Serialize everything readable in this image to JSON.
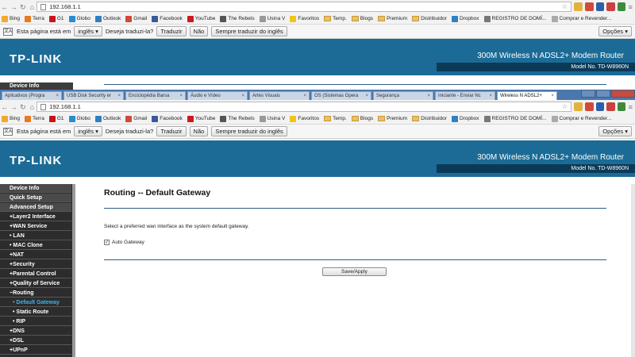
{
  "browser": {
    "url": "192.168.1.1",
    "bookmarks": [
      {
        "label": "Bing",
        "color": "#f3a92b",
        "kind": "icon"
      },
      {
        "label": "Terra",
        "color": "#e8791c",
        "kind": "icon"
      },
      {
        "label": "G1",
        "color": "#c4161c",
        "kind": "icon"
      },
      {
        "label": "Globo",
        "color": "#2a8bd1",
        "kind": "icon"
      },
      {
        "label": "Outlook",
        "color": "#2f7ec2",
        "kind": "icon"
      },
      {
        "label": "Gmail",
        "color": "#d44638",
        "kind": "icon"
      },
      {
        "label": "Facebook",
        "color": "#3b5998",
        "kind": "icon"
      },
      {
        "label": "YouTube",
        "color": "#cc181e",
        "kind": "icon"
      },
      {
        "label": "The Rebels",
        "color": "#555555",
        "kind": "icon"
      },
      {
        "label": "Usina V",
        "color": "#999999",
        "kind": "icon"
      },
      {
        "label": "Favoritos",
        "color": "#f0c419",
        "kind": "icon"
      },
      {
        "label": "Temp.",
        "kind": "folder"
      },
      {
        "label": "Blogs",
        "kind": "folder"
      },
      {
        "label": "Premium",
        "kind": "folder"
      },
      {
        "label": "Distribuidor",
        "kind": "folder"
      },
      {
        "label": "Dropbox",
        "color": "#2d81c4",
        "kind": "icon"
      },
      {
        "label": "REGISTRO DE DOMÍ...",
        "color": "#777777",
        "kind": "icon"
      },
      {
        "label": "Comprar e Revender...",
        "color": "#aaaaaa",
        "kind": "icon"
      }
    ],
    "translate": {
      "prefix": "Esta página está em",
      "language": "inglês",
      "question": "Deseja traduzi-la?",
      "translate_btn": "Traduzir",
      "no_btn": "Não",
      "always_btn": "Sempre traduzir do inglês",
      "options_btn": "Opções"
    },
    "tabs": [
      {
        "label": "Aplicativos (Progra"
      },
      {
        "label": "USB Disk Security er"
      },
      {
        "label": "Enciclopédia Barsa"
      },
      {
        "label": "Áudio e Vídeo"
      },
      {
        "label": "Artes Visuais"
      },
      {
        "label": "OS (Sistemas Opera"
      },
      {
        "label": "Segurança"
      },
      {
        "label": "Iniciante - Enviar Nc"
      },
      {
        "label": "Wireless N ADSL2+"
      }
    ]
  },
  "router": {
    "logo": "TP-LINK",
    "product_title": "300M Wireless N ADSL2+ Modem Router",
    "model": "Model No. TD-W8960N"
  },
  "menu": [
    {
      "label": "Device Info",
      "type": "top"
    },
    {
      "label": "Quick Setup",
      "type": "top"
    },
    {
      "label": "Advanced Setup",
      "type": "top"
    },
    {
      "label": "+Layer2 Interface",
      "type": "sub"
    },
    {
      "label": "+WAN Service",
      "type": "sub"
    },
    {
      "label": "• LAN",
      "type": "sub"
    },
    {
      "label": "• MAC Clone",
      "type": "sub"
    },
    {
      "label": "+NAT",
      "type": "sub"
    },
    {
      "label": "+Security",
      "type": "sub"
    },
    {
      "label": "+Parental Control",
      "type": "sub"
    },
    {
      "label": "+Quality of Service",
      "type": "sub"
    },
    {
      "label": "−Routing",
      "type": "sub"
    },
    {
      "label": "• Default Gateway",
      "type": "sub2",
      "selected": true
    },
    {
      "label": "• Static Route",
      "type": "sub2"
    },
    {
      "label": "• RIP",
      "type": "sub2"
    },
    {
      "label": "+DNS",
      "type": "sub"
    },
    {
      "label": "+DSL",
      "type": "sub"
    },
    {
      "label": "+UPnP",
      "type": "sub"
    }
  ],
  "content": {
    "title": "Routing -- Default Gateway",
    "description": "Select a preferred wan interface as the system default gateway.",
    "auto_gateway_label": "Auto Gateway",
    "auto_gateway_checked": true,
    "save_label": "Save/Apply"
  }
}
